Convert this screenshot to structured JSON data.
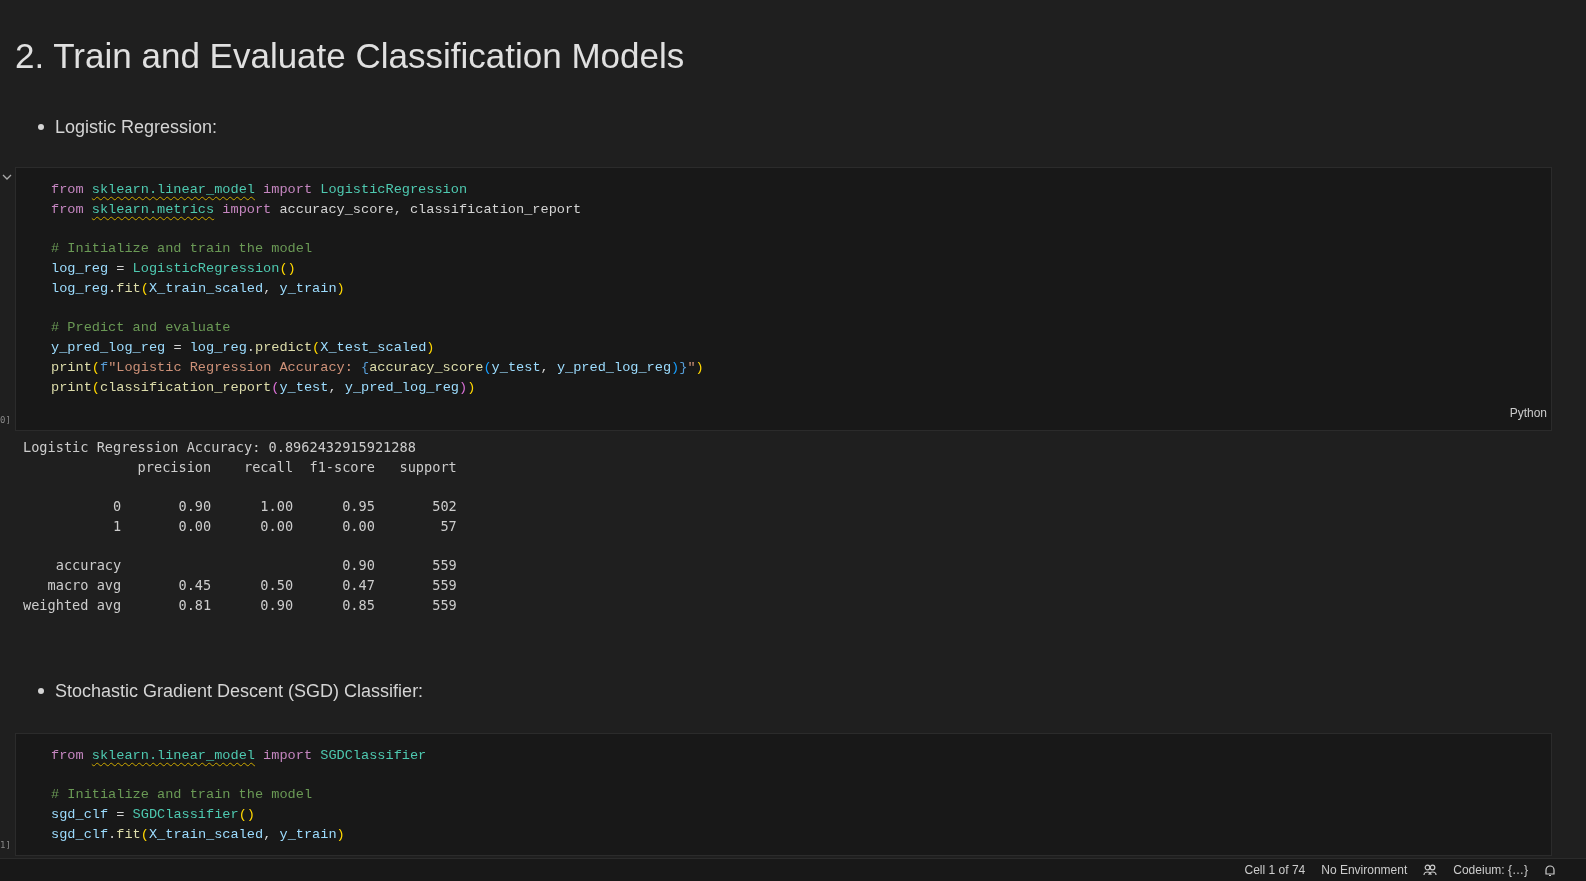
{
  "heading": "2. Train and Evaluate Classification Models",
  "sections": [
    {
      "bullet": "Logistic Regression:",
      "cell": {
        "collapsible": true,
        "execution": "0]",
        "language": "Python",
        "blocks": [
          [
            [
              {
                "text": "from ",
                "kind": "kw"
              },
              {
                "text": "sklearn.linear_model",
                "kind": "mod"
              },
              {
                "text": " import",
                "kind": "kw"
              },
              {
                "text": " LogisticRegression",
                "kind": "cls"
              }
            ],
            [
              {
                "text": "from ",
                "kind": "kw"
              },
              {
                "text": "sklearn.metrics",
                "kind": "mod"
              },
              {
                "text": " import",
                "kind": "kw"
              },
              {
                "text": " accuracy_score, classification_report",
                "kind": "p"
              }
            ]
          ],
          [
            [
              {
                "text": "# Initialize and train the model",
                "kind": "cm"
              }
            ],
            [
              {
                "text": "log_reg",
                "kind": "var"
              },
              {
                "text": " = ",
                "kind": "p"
              },
              {
                "text": "LogisticRegression",
                "kind": "cls"
              },
              {
                "text": "()",
                "kind": "p1"
              }
            ],
            [
              {
                "text": "log_reg",
                "kind": "var"
              },
              {
                "text": ".",
                "kind": "p"
              },
              {
                "text": "fit",
                "kind": "fn"
              },
              {
                "text": "(",
                "kind": "p1"
              },
              {
                "text": "X_train_scaled",
                "kind": "var"
              },
              {
                "text": ", ",
                "kind": "p"
              },
              {
                "text": "y_train",
                "kind": "var"
              },
              {
                "text": ")",
                "kind": "p1"
              }
            ]
          ],
          [
            [
              {
                "text": "# Predict and evaluate",
                "kind": "cm"
              }
            ],
            [
              {
                "text": "y_pred_log_reg",
                "kind": "var"
              },
              {
                "text": " = ",
                "kind": "p"
              },
              {
                "text": "log_reg",
                "kind": "var"
              },
              {
                "text": ".",
                "kind": "p"
              },
              {
                "text": "predict",
                "kind": "fn"
              },
              {
                "text": "(",
                "kind": "p1"
              },
              {
                "text": "X_test_scaled",
                "kind": "var"
              },
              {
                "text": ")",
                "kind": "p1"
              }
            ],
            [
              {
                "text": "print",
                "kind": "fn"
              },
              {
                "text": "(",
                "kind": "p1"
              },
              {
                "text": "f",
                "kind": "fs"
              },
              {
                "text": "\"Logistic Regression Accuracy: ",
                "kind": "str"
              },
              {
                "text": "{",
                "kind": "fs"
              },
              {
                "text": "accuracy_score",
                "kind": "fn"
              },
              {
                "text": "(",
                "kind": "p3"
              },
              {
                "text": "y_test",
                "kind": "var"
              },
              {
                "text": ", ",
                "kind": "p"
              },
              {
                "text": "y_pred_log_reg",
                "kind": "var"
              },
              {
                "text": ")",
                "kind": "p3"
              },
              {
                "text": "}",
                "kind": "fs"
              },
              {
                "text": "\"",
                "kind": "str"
              },
              {
                "text": ")",
                "kind": "p1"
              }
            ],
            [
              {
                "text": "print",
                "kind": "fn"
              },
              {
                "text": "(",
                "kind": "p1"
              },
              {
                "text": "classification_report",
                "kind": "fn"
              },
              {
                "text": "(",
                "kind": "p2"
              },
              {
                "text": "y_test",
                "kind": "var"
              },
              {
                "text": ", ",
                "kind": "p"
              },
              {
                "text": "y_pred_log_reg",
                "kind": "var"
              },
              {
                "text": ")",
                "kind": "p2"
              },
              {
                "text": ")",
                "kind": "p1"
              }
            ]
          ]
        ]
      },
      "output": [
        [
          "Logistic Regression Accuracy: 0.8962432915921288",
          "              precision    recall  f1-score   support"
        ],
        [
          "           0       0.90      1.00      0.95       502",
          "           1       0.00      0.00      0.00        57"
        ],
        [
          "    accuracy                           0.90       559",
          "   macro avg       0.45      0.50      0.47       559",
          "weighted avg       0.81      0.90      0.85       559"
        ]
      ]
    },
    {
      "bullet": "Stochastic Gradient Descent (SGD) Classifier:",
      "cell": {
        "collapsible": false,
        "execution": "1]",
        "blocks": [
          [
            [
              {
                "text": "from ",
                "kind": "kw"
              },
              {
                "text": "sklearn.linear_model",
                "kind": "mod"
              },
              {
                "text": " import",
                "kind": "kw"
              },
              {
                "text": " SGDClassifier",
                "kind": "cls"
              }
            ]
          ],
          [
            [
              {
                "text": "# Initialize and train the model",
                "kind": "cm"
              }
            ],
            [
              {
                "text": "sgd_clf",
                "kind": "var"
              },
              {
                "text": " = ",
                "kind": "p"
              },
              {
                "text": "SGDClassifier",
                "kind": "cls"
              },
              {
                "text": "()",
                "kind": "p1"
              }
            ],
            [
              {
                "text": "sgd_clf",
                "kind": "var"
              },
              {
                "text": ".",
                "kind": "p"
              },
              {
                "text": "fit",
                "kind": "fn"
              },
              {
                "text": "(",
                "kind": "p1"
              },
              {
                "text": "X_train_scaled",
                "kind": "var"
              },
              {
                "text": ", ",
                "kind": "p"
              },
              {
                "text": "y_train",
                "kind": "var"
              },
              {
                "text": ")",
                "kind": "p1"
              }
            ]
          ]
        ]
      }
    }
  ],
  "status_bar": {
    "cell": "Cell 1 of 74",
    "environment": "No Environment",
    "codeium": "Codeium: {…}"
  }
}
